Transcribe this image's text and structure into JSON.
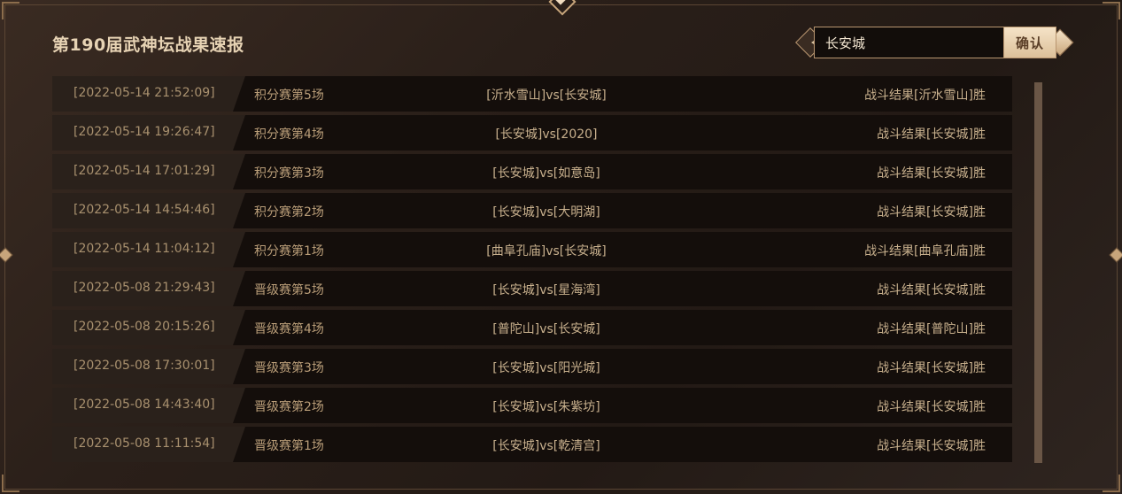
{
  "header": {
    "title": "第190届武神坛战果速报"
  },
  "search": {
    "value": "长安城",
    "confirm_label": "确认"
  },
  "rows": [
    {
      "time": "[2022-05-14 21:52:09]",
      "stage": "积分赛第5场",
      "match": "[沂水雪山]vs[长安城]",
      "result": "战斗结果[沂水雪山]胜"
    },
    {
      "time": "[2022-05-14 19:26:47]",
      "stage": "积分赛第4场",
      "match": "[长安城]vs[2020]",
      "result": "战斗结果[长安城]胜"
    },
    {
      "time": "[2022-05-14 17:01:29]",
      "stage": "积分赛第3场",
      "match": "[长安城]vs[如意岛]",
      "result": "战斗结果[长安城]胜"
    },
    {
      "time": "[2022-05-14 14:54:46]",
      "stage": "积分赛第2场",
      "match": "[长安城]vs[大明湖]",
      "result": "战斗结果[长安城]胜"
    },
    {
      "time": "[2022-05-14 11:04:12]",
      "stage": "积分赛第1场",
      "match": "[曲阜孔庙]vs[长安城]",
      "result": "战斗结果[曲阜孔庙]胜"
    },
    {
      "time": "[2022-05-08 21:29:43]",
      "stage": "晋级赛第5场",
      "match": "[长安城]vs[星海湾]",
      "result": "战斗结果[长安城]胜"
    },
    {
      "time": "[2022-05-08 20:15:26]",
      "stage": "晋级赛第4场",
      "match": "[普陀山]vs[长安城]",
      "result": "战斗结果[普陀山]胜"
    },
    {
      "time": "[2022-05-08 17:30:01]",
      "stage": "晋级赛第3场",
      "match": "[长安城]vs[阳光城]",
      "result": "战斗结果[长安城]胜"
    },
    {
      "time": "[2022-05-08 14:43:40]",
      "stage": "晋级赛第2场",
      "match": "[长安城]vs[朱紫坊]",
      "result": "战斗结果[长安城]胜"
    },
    {
      "time": "[2022-05-08 11:11:54]",
      "stage": "晋级赛第1场",
      "match": "[长安城]vs[乾清宫]",
      "result": "战斗结果[长安城]胜"
    }
  ],
  "icons": {
    "search_left": "chevron-left-icon",
    "search_right": "chevron-right-icon",
    "frame_top": "diamond-ornament-icon",
    "frame_sides": "diamond-ornament-icon"
  },
  "colors": {
    "accent": "#e7d3b4",
    "row_bg": "#140e0b",
    "time_bg": "#2a211b",
    "button_bg": "#f0dcc0"
  }
}
